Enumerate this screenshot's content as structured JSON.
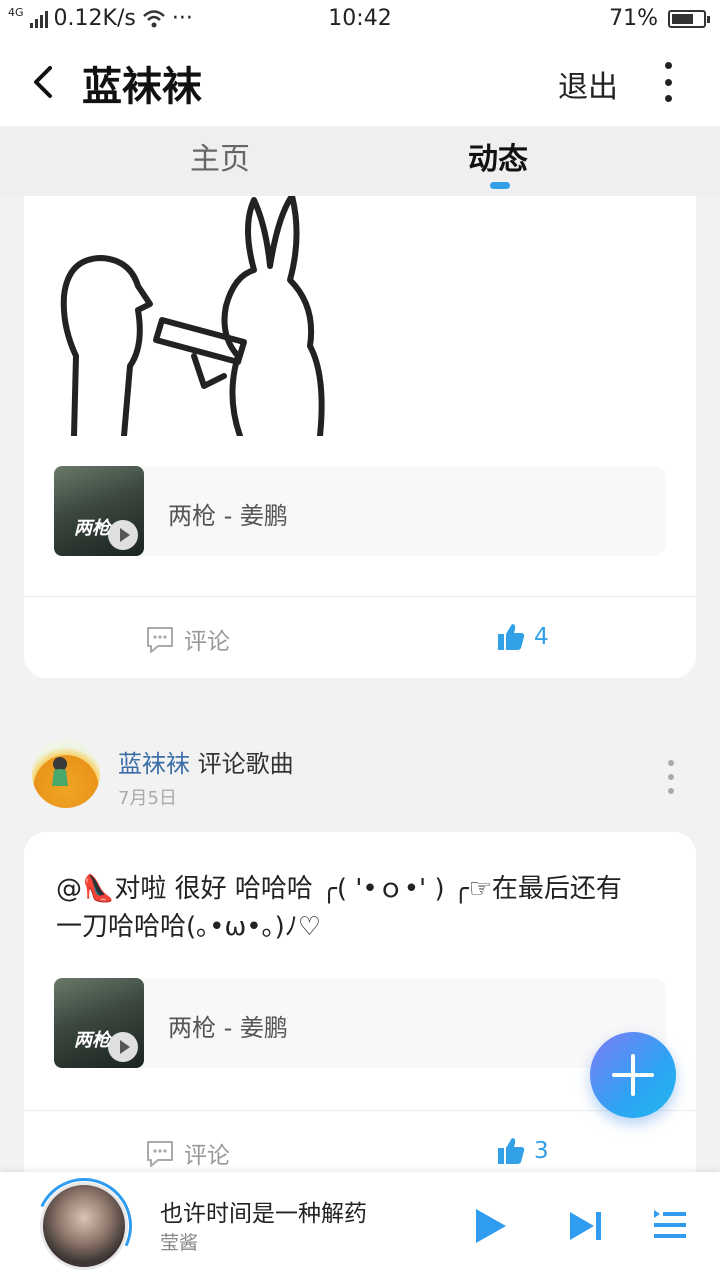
{
  "status": {
    "network": "4G",
    "speed": "0.12K/s",
    "dots": "···",
    "time": "10:42",
    "battery": "71%",
    "battery_level": 0.71
  },
  "header": {
    "title": "蓝袜袜",
    "logout_label": "退出"
  },
  "tabs": [
    {
      "label": "主页",
      "active": false
    },
    {
      "label": "动态",
      "active": true
    }
  ],
  "posts": [
    {
      "song": {
        "title": "两枪 - 姜鹏",
        "cover_text": "两枪"
      },
      "comment_label": "评论",
      "likes": "4"
    },
    {
      "author": "蓝袜袜",
      "action": "评论歌曲",
      "date": "7月5日",
      "text": "@👠对啦 很好 哈哈哈 ╭( '•ｏ•' ) ╭☞在最后还有一刀哈哈哈(｡•ω•｡)ﾉ♡",
      "song": {
        "title": "两枪 - 姜鹏",
        "cover_text": "两枪"
      },
      "comment_label": "评论",
      "likes": "3"
    }
  ],
  "player": {
    "title": "也许时间是一种解药",
    "artist": "莹酱"
  },
  "colors": {
    "accent": "#31a0e6",
    "author": "#3d6ea8"
  }
}
